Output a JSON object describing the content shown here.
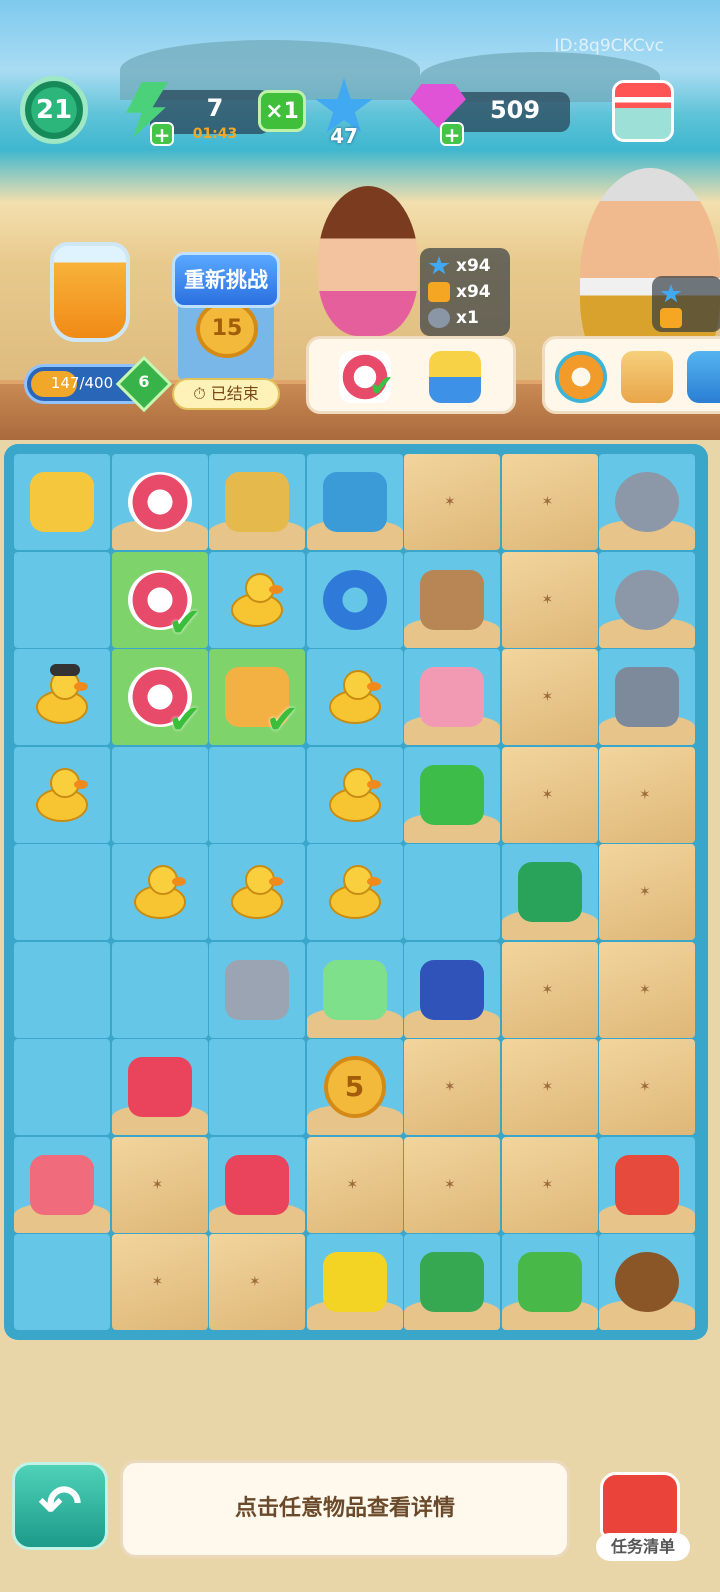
{
  "user_id": "ID:8q9CKCvc",
  "top_bar": {
    "level": "21",
    "energy": {
      "value": "7",
      "timer": "01:43",
      "multiplier": "×1"
    },
    "stars": "47",
    "gems": "509"
  },
  "jar": {
    "progress": "147/400",
    "progress_fraction": 0.3675,
    "level": "6"
  },
  "challenge": {
    "retry_label": "重新挑战",
    "coin_value": "15",
    "status": "已结束"
  },
  "requirements": [
    {
      "icon": "star-icon",
      "count": "x94"
    },
    {
      "icon": "juice-icon",
      "count": "x94"
    },
    {
      "icon": "rock-icon",
      "count": "x1"
    }
  ],
  "orders": [
    {
      "items": [
        "swim-ring-ball-icon",
        "sand-toy-truck-icon"
      ],
      "first_done": true
    },
    {
      "items": [
        "donut-float-icon",
        "shell-bucket-icon",
        "sand-bucket-icon"
      ]
    }
  ],
  "board": {
    "cols": 7,
    "rows": 9,
    "cells": [
      [
        "sandcastle",
        "swim-ring-ball",
        "surf-cart",
        "parrot",
        "sand",
        "sand",
        "rock"
      ],
      [
        "empty",
        "swim-ring-ball-done",
        "duck",
        "whale-float",
        "pelican",
        "sand",
        "rock"
      ],
      [
        "duck-hat",
        "swim-ring-ball-done",
        "shell-bucket-done",
        "duck",
        "conch-shell",
        "sand",
        "rock-plant"
      ],
      [
        "duck",
        "empty",
        "empty",
        "duck",
        "green-parrot",
        "sand",
        "sand"
      ],
      [
        "empty",
        "duck",
        "duck",
        "duck",
        "empty",
        "green-shell",
        "sand"
      ],
      [
        "empty",
        "empty",
        "juicer",
        "green-energy",
        "blue-bird",
        "sand",
        "sand"
      ],
      [
        "empty",
        "watermelon-juice",
        "empty",
        "coin-5",
        "sand",
        "sand",
        "sand"
      ],
      [
        "fruit-drink",
        "sand",
        "juice-jug",
        "sand",
        "sand",
        "sand",
        "watermelon-plate"
      ],
      [
        "empty",
        "sand",
        "sand",
        "yellow-flowers",
        "potted-plant",
        "sprout",
        "seed"
      ]
    ],
    "coin_value": "5"
  },
  "bottom": {
    "info_text": "点击任意物品查看详情",
    "task_label": "任务清单"
  },
  "colors": {
    "board_bg": "#3aa6c9",
    "cell_bg": "#66c6e8",
    "done_bg": "#7fd36b",
    "sand": "#e7c489"
  }
}
